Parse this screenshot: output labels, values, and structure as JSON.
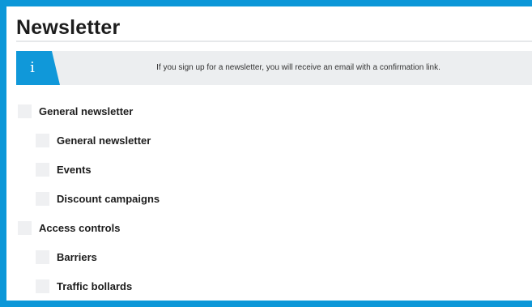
{
  "page": {
    "title": "Newsletter"
  },
  "info": {
    "icon": "info-icon",
    "glyph": "i",
    "message": "If you sign up for a newsletter, you will receive an email with a confirmation link."
  },
  "groups": [
    {
      "label": "General newsletter",
      "checked": false,
      "items": [
        {
          "label": "General newsletter",
          "checked": false
        },
        {
          "label": "Events",
          "checked": false
        },
        {
          "label": "Discount campaigns",
          "checked": false
        }
      ]
    },
    {
      "label": "Access controls",
      "checked": false,
      "items": [
        {
          "label": "Barriers",
          "checked": false
        },
        {
          "label": "Traffic bollards",
          "checked": false
        }
      ]
    }
  ],
  "colors": {
    "accent": "#0c97d8",
    "banner_bg": "#eceef0",
    "checkbox_bg": "#eff0f2"
  }
}
